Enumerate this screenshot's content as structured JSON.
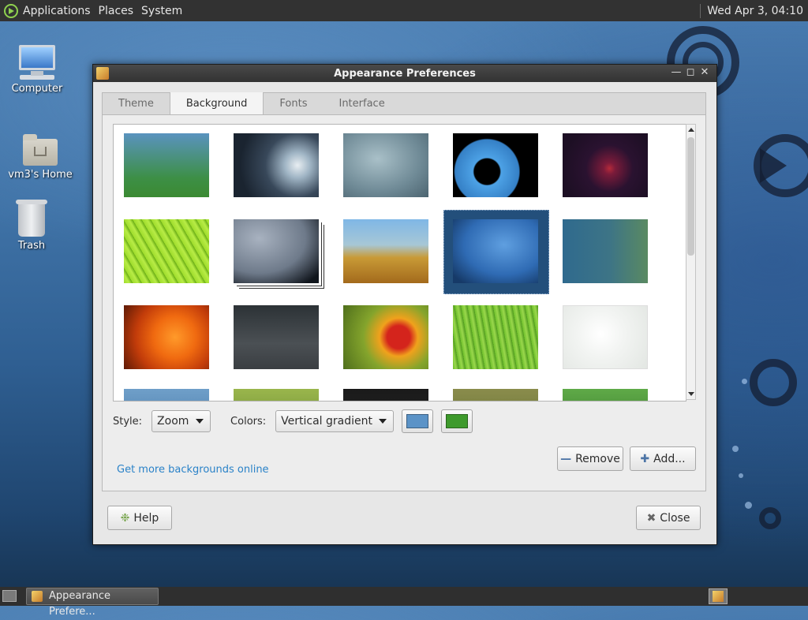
{
  "top_panel": {
    "menus": [
      "Applications",
      "Places",
      "System"
    ],
    "clock": "Wed Apr 3, 04:10"
  },
  "desktop": {
    "icons": [
      {
        "label": "Computer",
        "icon": "computer-icon"
      },
      {
        "label": "vm3's Home",
        "icon": "home-folder-icon"
      },
      {
        "label": "Trash",
        "icon": "trash-icon"
      }
    ]
  },
  "window": {
    "title": "Appearance Preferences",
    "tabs": [
      "Theme",
      "Background",
      "Fonts",
      "Interface"
    ],
    "active_tab": "Background",
    "backgrounds": [
      {
        "style": "linear-gradient(180deg,#5a93bf,#3d8f46 70%,#3b8a32)"
      },
      {
        "style": "radial-gradient(circle at 75% 50%,#e8eef2 0%,#9fb4c4 18%,#38485a 45%,#1a2430 80%)"
      },
      {
        "style": "radial-gradient(ellipse at 40% 40%,#a9c0c8,#6f8a96 60%,#4c6470)"
      },
      {
        "style": "radial-gradient(circle at 40% 60%,#000 0%,#000 20%,#4da2e6 22%,#3580c6 50%,#000 52%),linear-gradient(120deg,#000 60%,#e23c3c 66%,#f0a230 70%,#f2e23c 74%,#48c04c 78%,#3d6ed8 82%,#000 86%)"
      },
      {
        "style": "radial-gradient(circle at 55% 55%,#b52a3a 0%,#7b1b3a 10%,#2a1230 40%,#1d0f24 80%)"
      },
      {
        "style": "repeating-linear-gradient(60deg,#9fdc2c 0px,#b8ec46 6px,#68ac14 10px)"
      },
      {
        "style": "radial-gradient(ellipse at 30% 30%,#a8b2c0,#6e7a8a 55%,#10151c 90%)"
      },
      {
        "style": "linear-gradient(180deg,#7fb7e6 0%,#a7c7d6 40%,#c89a36 60%,#a36a1c 100%)"
      },
      {
        "style": "radial-gradient(ellipse at 60% 40%,#5f9fe0,#2f6bb4 55%,#163a68 90%)"
      },
      {
        "style": "linear-gradient(90deg,#2f6a8e,#3d7486 55%,#5a8a62)"
      },
      {
        "style": "radial-gradient(circle at 60% 50%,#ff9a2a 0%,#f06a10 35%,#c23c0a 65%,#5e1a06 100%)"
      },
      {
        "style": "linear-gradient(180deg,#2c3236,#4b5054 60%,#3a3e42)"
      },
      {
        "style": "radial-gradient(circle at 65% 50%,#d4241c 0%,#d4241c 18%,#f0a21c 30%,#84a42c 55%,#4f6f1c 100%)"
      },
      {
        "style": "repeating-linear-gradient(80deg,#6fbf2c 0px,#9ad84c 4px,#4f9a1e 8px)"
      },
      {
        "style": "radial-gradient(circle at 45% 45%,#ffffff 0%,#f2f4f2 40%,#e2e6e2 100%)"
      },
      {
        "style": "linear-gradient(180deg,#6f9fc9,#3e6e9c)"
      },
      {
        "style": "linear-gradient(180deg,#9ab64c,#5b7a2c)"
      },
      {
        "style": "linear-gradient(180deg,#1a1a1a,#2a2a2a)"
      },
      {
        "style": "linear-gradient(180deg,#8a8c4c,#5b6a2c)"
      },
      {
        "style": "linear-gradient(180deg,#5faa48,#2f6a22)"
      }
    ],
    "selected_index": 8,
    "style_label": "Style:",
    "style_value": "Zoom",
    "colors_label": "Colors:",
    "colors_value": "Vertical gradient",
    "primary_color": "#5b93c7",
    "secondary_color": "#3e9a2c",
    "more_link": "Get more backgrounds online",
    "remove_label": "Remove",
    "add_label": "Add...",
    "help_label": "Help",
    "close_label": "Close"
  },
  "taskbar": {
    "task_label": "Appearance Prefere..."
  }
}
